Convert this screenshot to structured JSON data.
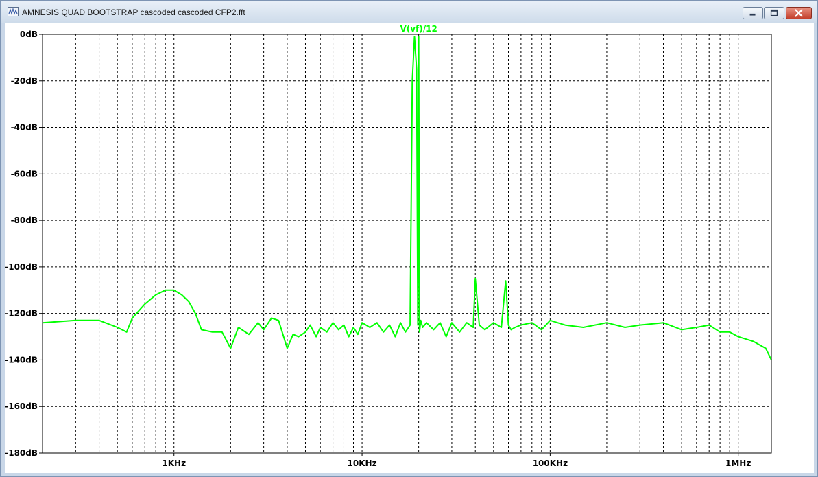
{
  "window": {
    "title": "AMNESIS QUAD BOOTSTRAP cascoded cascoded CFP2.fft",
    "icon": "waveform-icon",
    "minimize_icon": "minimize-icon",
    "restore_icon": "restore-icon",
    "close_icon": "close-icon"
  },
  "colors": {
    "trace": "#00ff00",
    "grid": "#000000",
    "background": "#ffffff",
    "frame": "#c9d7e8"
  },
  "chart_data": {
    "type": "line",
    "title": "",
    "xlabel": "",
    "ylabel": "",
    "x_scale": "log",
    "xlim": [
      200,
      1500000
    ],
    "ylim": [
      -180,
      0
    ],
    "grid": true,
    "x_ticks": [
      {
        "value": 1000,
        "label": "1KHz"
      },
      {
        "value": 10000,
        "label": "10KHz"
      },
      {
        "value": 100000,
        "label": "100KHz"
      },
      {
        "value": 1000000,
        "label": "1MHz"
      }
    ],
    "y_ticks": [
      {
        "value": 0,
        "label": "0dB"
      },
      {
        "value": -20,
        "label": "-20dB"
      },
      {
        "value": -40,
        "label": "-40dB"
      },
      {
        "value": -60,
        "label": "-60dB"
      },
      {
        "value": -80,
        "label": "-80dB"
      },
      {
        "value": -100,
        "label": "-100dB"
      },
      {
        "value": -120,
        "label": "-120dB"
      },
      {
        "value": -140,
        "label": "-140dB"
      },
      {
        "value": -160,
        "label": "-160dB"
      },
      {
        "value": -180,
        "label": "-180dB"
      }
    ],
    "series": [
      {
        "name": "V(vf)/12",
        "color": "#00ff00",
        "x": [
          200,
          300,
          400,
          500,
          560,
          600,
          700,
          800,
          900,
          1000,
          1100,
          1200,
          1300,
          1400,
          1600,
          1800,
          2000,
          2200,
          2500,
          2800,
          3000,
          3300,
          3600,
          4000,
          4300,
          4600,
          5000,
          5300,
          5700,
          6000,
          6500,
          7000,
          7500,
          8000,
          8500,
          9000,
          9500,
          10000,
          11000,
          12000,
          13000,
          14000,
          15000,
          16000,
          17000,
          18000,
          18500,
          19000,
          19500,
          19800,
          20000,
          20200,
          20500,
          21000,
          22000,
          24000,
          26000,
          28000,
          30000,
          33000,
          36000,
          39000,
          40000,
          42000,
          45000,
          50000,
          55000,
          58000,
          60000,
          62000,
          65000,
          70000,
          80000,
          90000,
          100000,
          120000,
          150000,
          200000,
          250000,
          300000,
          400000,
          500000,
          600000,
          700000,
          800000,
          900000,
          1000000,
          1200000,
          1400000,
          1500000
        ],
        "y": [
          -124,
          -123,
          -123,
          -126,
          -128,
          -122,
          -116,
          -112,
          -110,
          -110,
          -112,
          -115,
          -120,
          -127,
          -128,
          -128,
          -135,
          -126,
          -129,
          -124,
          -127,
          -122,
          -123,
          -135,
          -129,
          -130,
          -128,
          -125,
          -130,
          -126,
          -128,
          -124,
          -127,
          -125,
          -130,
          -126,
          -129,
          -124,
          -126,
          -124,
          -128,
          -125,
          -130,
          -124,
          -128,
          -125,
          -20,
          -1,
          -15,
          -125,
          -1,
          -128,
          -123,
          -126,
          -124,
          -127,
          -124,
          -130,
          -124,
          -128,
          -124,
          -126,
          -105,
          -125,
          -127,
          -124,
          -126,
          -106,
          -125,
          -127,
          -126,
          -125,
          -124,
          -127,
          -123,
          -125,
          -126,
          -124,
          -126,
          -125,
          -124,
          -127,
          -126,
          -125,
          -128,
          -128,
          -130,
          -132,
          -135,
          -140
        ]
      }
    ]
  }
}
